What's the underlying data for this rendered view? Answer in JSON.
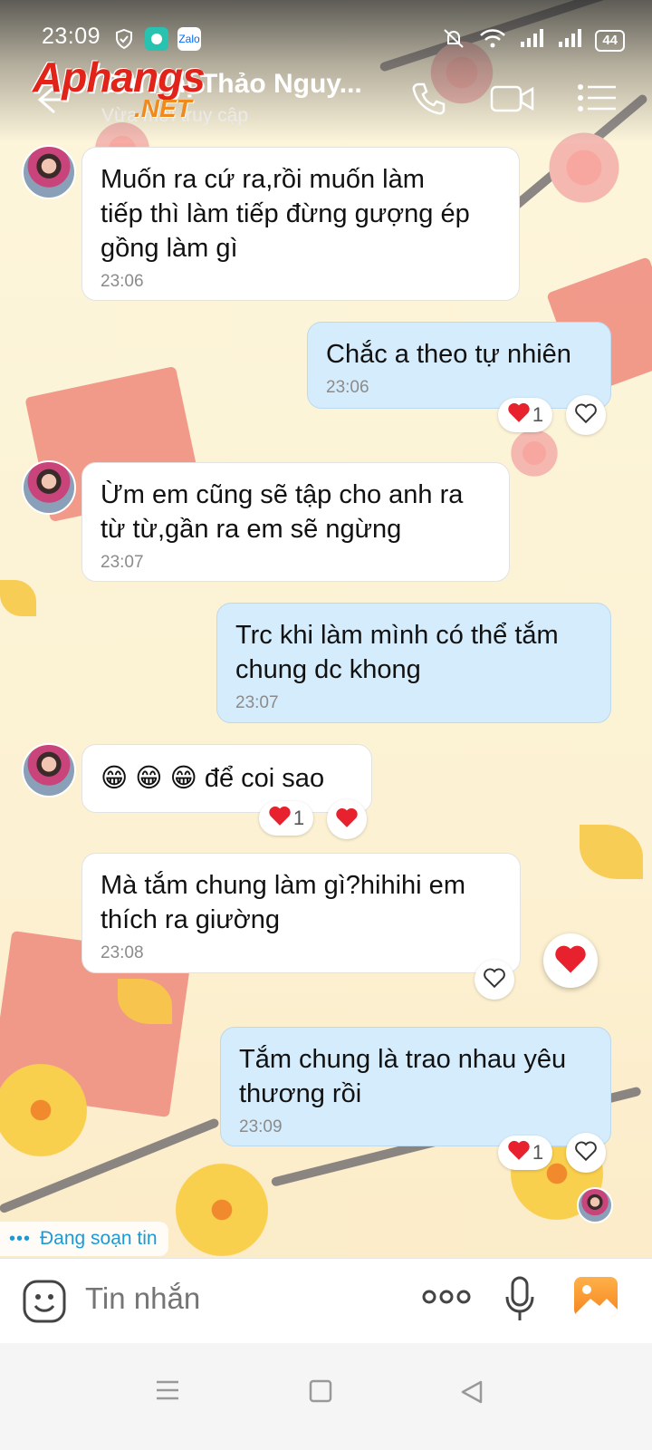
{
  "status_bar": {
    "time": "23:09",
    "app_icons": [
      "shield-check-icon",
      "chat-bubble-icon",
      "zalo-icon"
    ],
    "battery": "44"
  },
  "header": {
    "title": "Bùi Thị Thảo Nguy...",
    "subtitle": "Vừa mới truy cập",
    "watermark_main": "Aphangs",
    "watermark_sub": ".NET"
  },
  "messages": [
    {
      "side": "in",
      "text_lines": [
        "Muốn ra cứ ra,rồi muốn làm",
        "tiếp thì làm tiếp đừng gượng ép",
        "gồng làm gì"
      ],
      "time": "23:06"
    },
    {
      "side": "out",
      "text_lines": [
        "Chắc a theo tự nhiên"
      ],
      "time": "23:06",
      "reaction_count": "1"
    },
    {
      "side": "in",
      "text_lines": [
        "Ừm em cũng sẽ tập cho anh ra",
        "từ từ,gần ra em sẽ ngừng"
      ],
      "time": "23:07"
    },
    {
      "side": "out",
      "text_lines": [
        "Trc khi làm mình có thể tắm",
        "chung dc khong"
      ],
      "time": "23:07"
    },
    {
      "side": "in",
      "text": "😁 😁 😁 để coi sao",
      "reaction_count": "1"
    },
    {
      "side": "in",
      "text_lines": [
        "Mà tắm chung làm gì?hihihi em",
        "thích ra giường"
      ],
      "time": "23:08"
    },
    {
      "side": "out",
      "text_lines": [
        "Tắm chung là trao nhau yêu",
        "thương rồi"
      ],
      "time": "23:09",
      "reaction_count": "1"
    }
  ],
  "typing_indicator": "Đang soạn tin",
  "input": {
    "placeholder": "Tin nhắn"
  },
  "colors": {
    "outgoing_bubble": "#d4ecfb",
    "incoming_bubble": "#ffffff",
    "accent": "#1c9ad6",
    "heart": "#e8212f"
  }
}
